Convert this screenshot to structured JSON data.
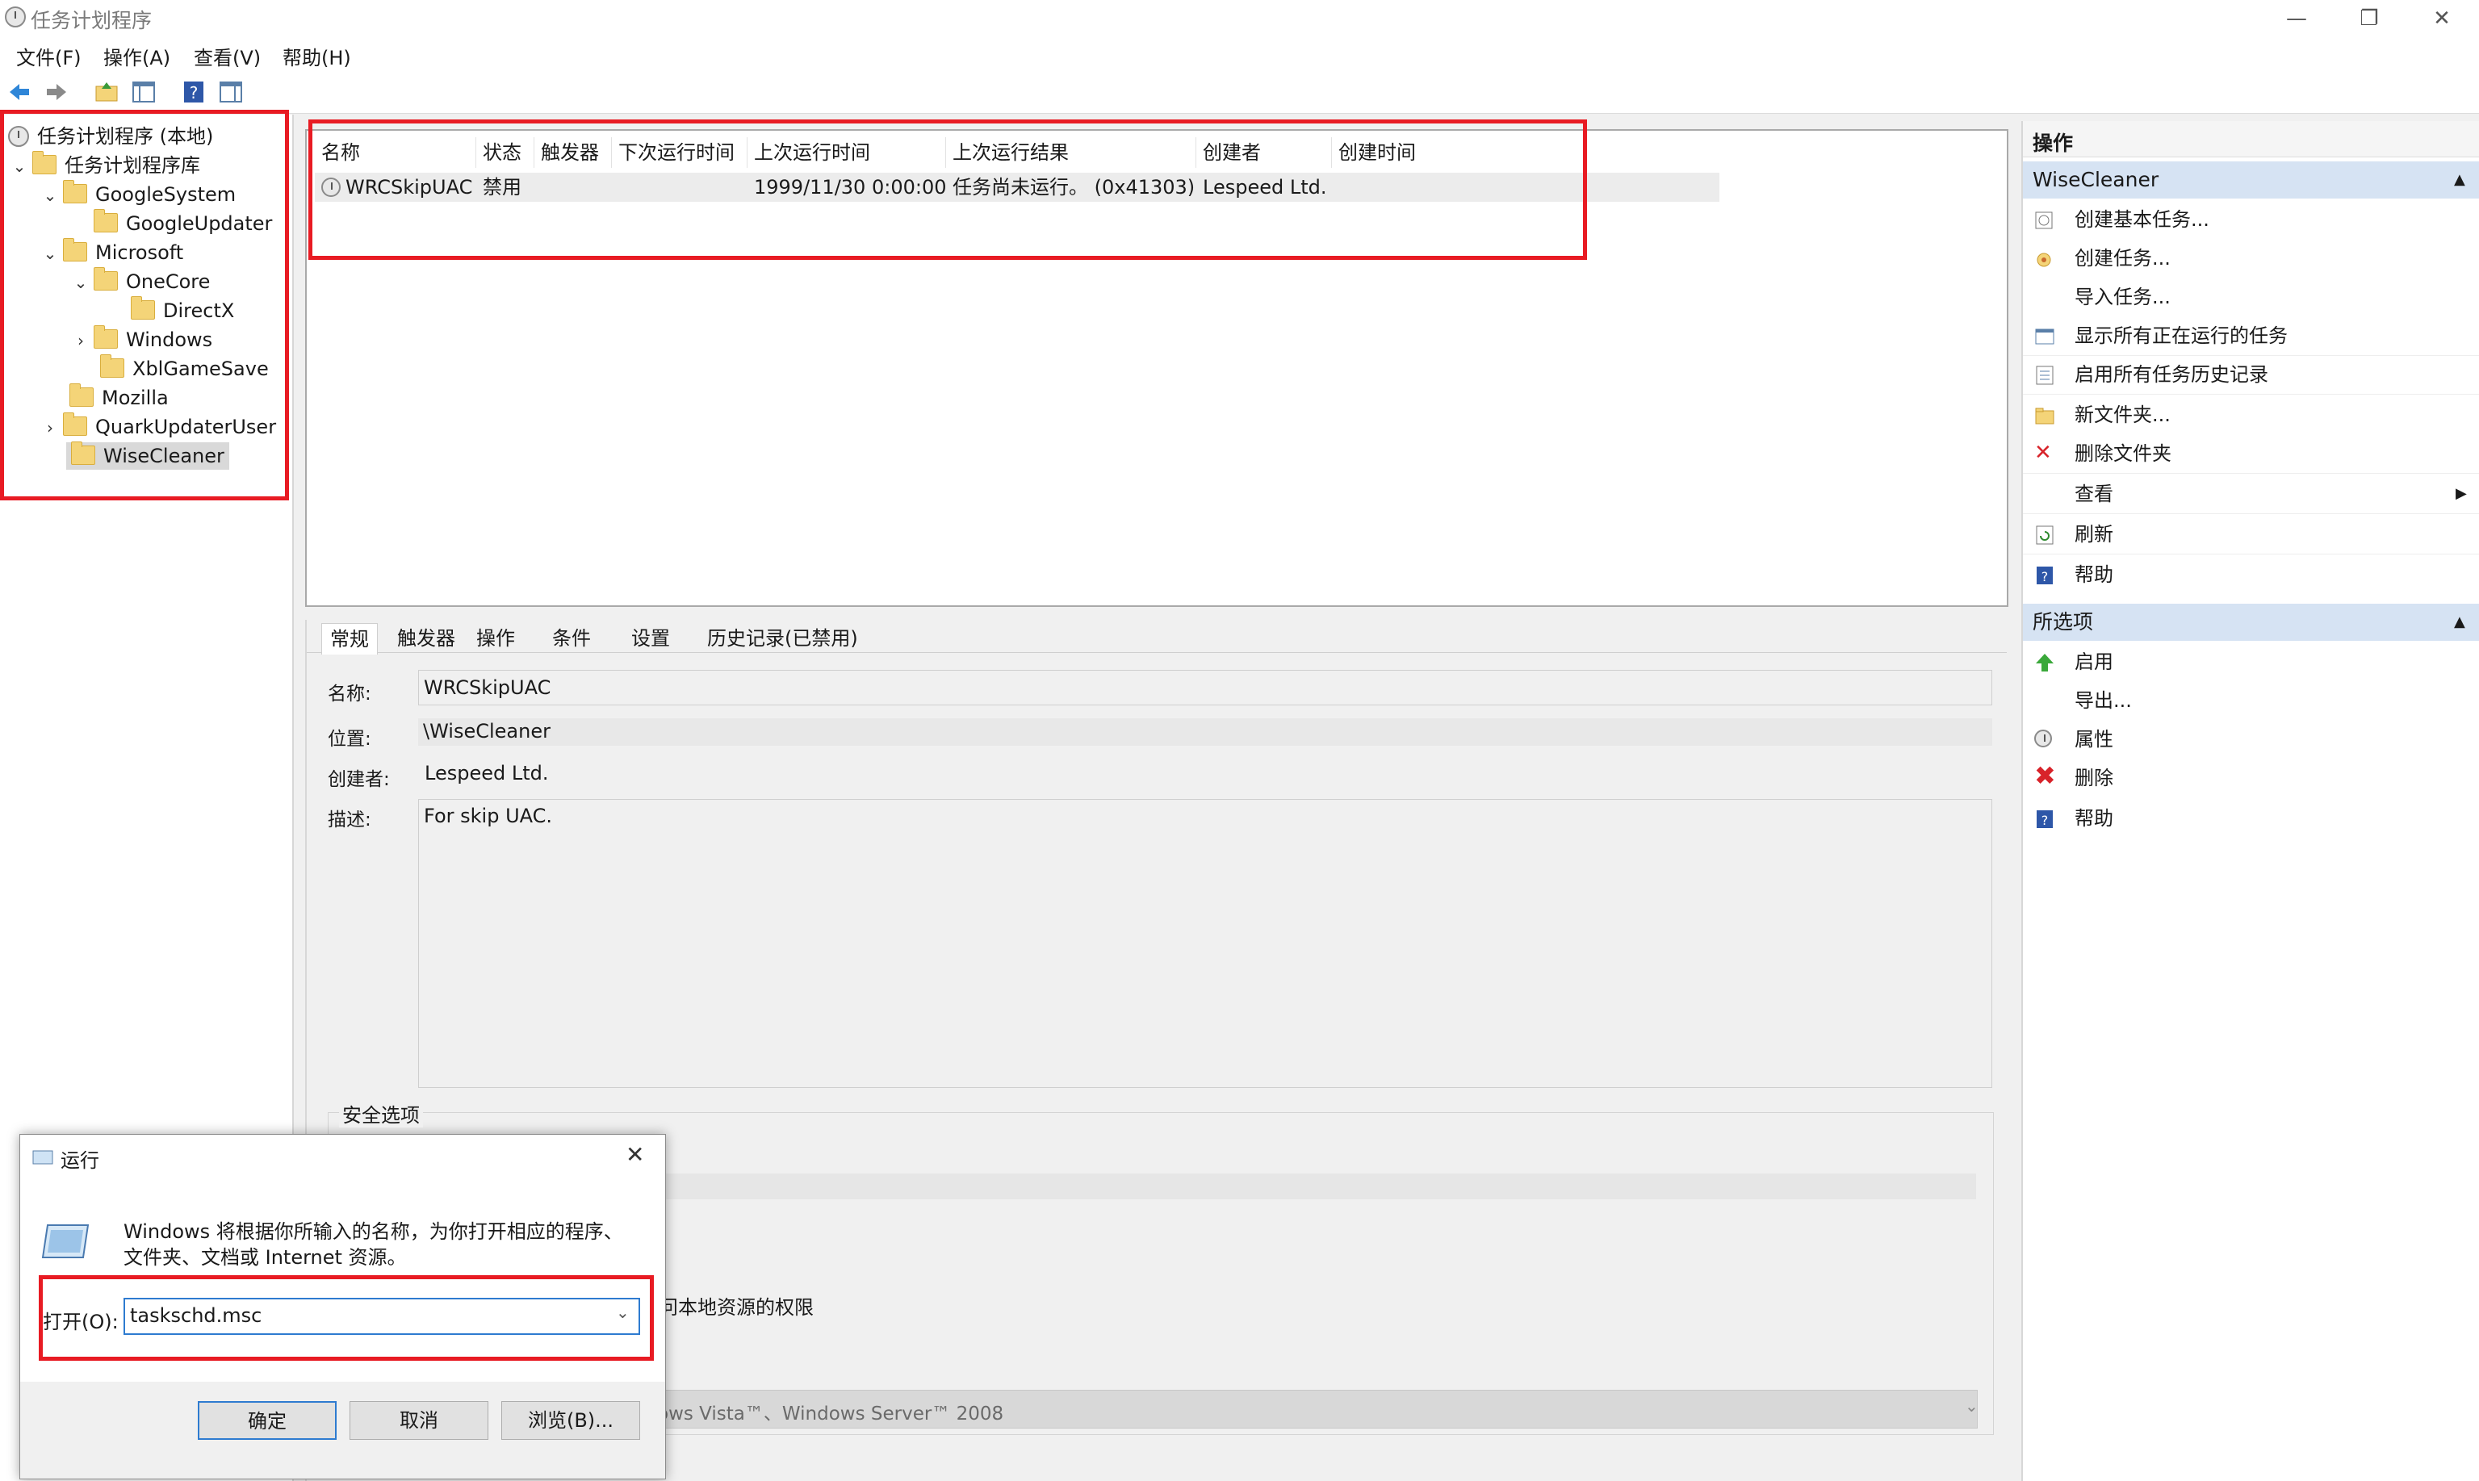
{
  "window": {
    "title": "任务计划程序"
  },
  "menu": [
    "文件(F)",
    "操作(A)",
    "查看(V)",
    "帮助(H)"
  ],
  "tree": {
    "root": "任务计划程序 (本地)",
    "library": "任务计划程序库",
    "items": [
      "GoogleSystem",
      "GoogleUpdater",
      "Microsoft",
      "OneCore",
      "DirectX",
      "Windows",
      "XblGameSave",
      "Mozilla",
      "QuarkUpdaterUser",
      "WiseCleaner"
    ]
  },
  "tasklist": {
    "columns": [
      "名称",
      "状态",
      "触发器",
      "下次运行时间",
      "上次运行时间",
      "上次运行结果",
      "创建者",
      "创建时间"
    ],
    "row": {
      "name": "WRCSkipUAC",
      "status": "禁用",
      "last_run": "1999/11/30 0:00:00",
      "last_result": "任务尚未运行。 (0x41303)",
      "author": "Lespeed Ltd."
    }
  },
  "details": {
    "tabs": [
      "常规",
      "触发器",
      "操作",
      "条件",
      "设置",
      "历史记录(已禁用)"
    ],
    "name_label": "名称:",
    "name_value": "WRCSkipUAC",
    "location_label": "位置:",
    "location_value": "\\WiseCleaner",
    "author_label": "创建者:",
    "author_value": "Lespeed Ltd.",
    "desc_label": "描述:",
    "desc_value": "For skip UAC.",
    "security_label": "安全选项",
    "partial_text_1": "问本地资源的权限",
    "configure_value_partial": "ows Vista™、Windows Server™ 2008"
  },
  "actions": {
    "section1": "操作",
    "section2": "WiseCleaner",
    "items": [
      "创建基本任务...",
      "创建任务...",
      "导入任务...",
      "显示所有正在运行的任务",
      "启用所有任务历史记录",
      "新文件夹...",
      "删除文件夹",
      "查看",
      "刷新",
      "帮助"
    ],
    "section3": "所选项",
    "selected_items": [
      "启用",
      "导出...",
      "属性",
      "删除",
      "帮助"
    ]
  },
  "run_dialog": {
    "title": "运行",
    "description_line1": "Windows 将根据你所输入的名称，为你打开相应的程序、",
    "description_line2": "文件夹、文档或 Internet 资源。",
    "open_label": "打开(O):",
    "open_value": "taskschd.msc",
    "ok": "确定",
    "cancel": "取消",
    "browse": "浏览(B)..."
  },
  "colors": {
    "highlight": "#e81b23",
    "section_bg": "#d6e3f3"
  }
}
